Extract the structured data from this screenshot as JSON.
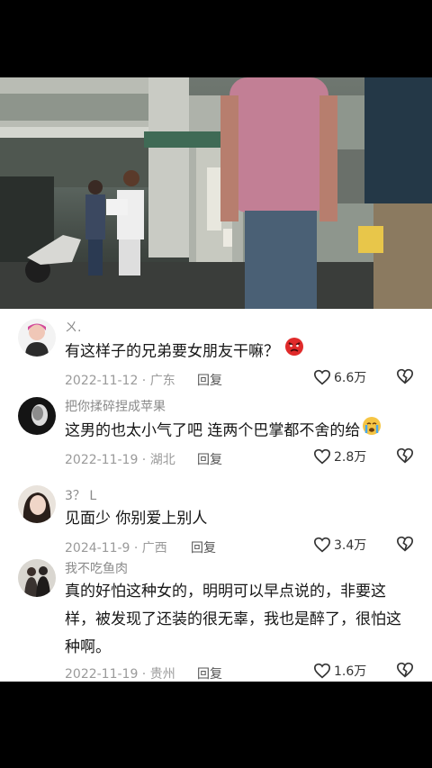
{
  "comments": [
    {
      "username": "ㄨ.",
      "text": "有这样子的兄弟要女朋友干嘛？",
      "emoji": "angry-face",
      "date_location": "2022-11-12 · 广东",
      "reply_label": "回复",
      "likes": "6.6万"
    },
    {
      "username": "把你揉碎捏成苹果",
      "text": "这男的也太小气了吧  连两个巴掌都不舍的给",
      "emoji": "crying-face",
      "date_location": "2022-11-19 · 湖北",
      "reply_label": "回复",
      "likes": "2.8万"
    },
    {
      "username": "3？ L",
      "text": "见面少 你别爱上别人",
      "emoji": "",
      "date_location": "2024-11-9 · 广西",
      "reply_label": "回复",
      "likes": "3.4万"
    },
    {
      "username": "我不吃鱼肉",
      "text": "真的好怕这种女的，明明可以早点说的，非要这样，被发现了还装的很无辜，我也是醉了，很怕这种啊。",
      "emoji": "",
      "date_location": "2022-11-19 · 贵州",
      "reply_label": "回复",
      "likes": "1.6万"
    }
  ],
  "colors": {
    "background": "#000000",
    "comment_bg": "#ffffff",
    "text": "#161616",
    "meta": "#9a9a9a"
  }
}
